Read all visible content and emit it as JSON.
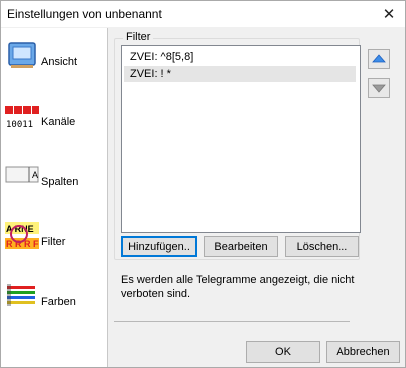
{
  "window": {
    "title": "Einstellungen von unbenannt"
  },
  "nav": {
    "items": [
      {
        "label": "Ansicht",
        "icon": "view-icon"
      },
      {
        "label": "Kanäle",
        "icon": "channels-icon",
        "icon_text": "10011"
      },
      {
        "label": "Spalten",
        "icon": "columns-icon",
        "icon_text": "A"
      },
      {
        "label": "Filter",
        "icon": "filter-icon",
        "icon_text_top": "A RNE",
        "icon_text_bottom": "R R R F"
      },
      {
        "label": "Farben",
        "icon": "colors-icon"
      }
    ]
  },
  "filter": {
    "legend": "Filter",
    "items": [
      "ZVEI: ^8[5,8]",
      "ZVEI: ! *"
    ],
    "selected_index": 1,
    "buttons": {
      "add": "Hinzufügen..",
      "edit": "Bearbeiten",
      "delete": "Löschen..."
    },
    "info": "Es werden alle Telegramme angezeigt, die nicht verboten sind."
  },
  "footer": {
    "ok": "OK",
    "cancel": "Abbrechen"
  },
  "colors": {
    "accent": "#0078d7",
    "arrow_up": "#3c8ce8",
    "arrow_down": "#9a9a9a"
  }
}
